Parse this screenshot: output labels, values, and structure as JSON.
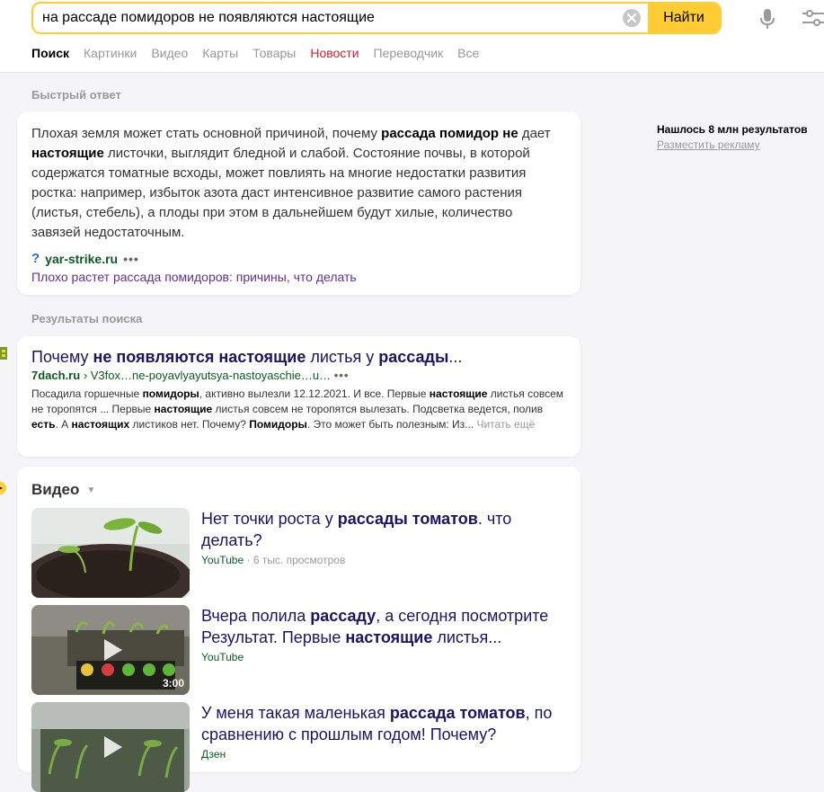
{
  "search": {
    "query": "на рассаде помидоров не появляются настоящие",
    "button": "Найти"
  },
  "tabs": [
    "Поиск",
    "Картинки",
    "Видео",
    "Карты",
    "Товары",
    "Новости",
    "Переводчик",
    "Все"
  ],
  "quick_answer": {
    "section_title": "Быстрый ответ",
    "text_parts": [
      {
        "t": "Плохая земля может стать основной причиной, почему "
      },
      {
        "t": "рассада помидор не",
        "b": true
      },
      {
        "t": " дает "
      },
      {
        "t": "настоящие",
        "b": true
      },
      {
        "t": " листочки, выглядит бледной и слабой. Состояние почвы, в которой содержатся томатные всходы, может повлиять на многие недостатки развития ростка: например, избыток азота даст интенсивное развитие самого растения (листья, стебель), а плоды при этом в дальнейшем будут хилые, количество завязей недостаточным."
      }
    ],
    "source_icon": "?",
    "source_host": "yar-strike.ru",
    "dots": "•••",
    "link_text": "Плохо растет рассада помидоров: причины, что делать"
  },
  "results": {
    "section_title": "Результаты поиска",
    "items": [
      {
        "title_parts": [
          {
            "t": "Почему "
          },
          {
            "t": "не появляются настоящие",
            "b": true
          },
          {
            "t": " листья у "
          },
          {
            "t": "рассады",
            "b": true
          },
          {
            "t": "..."
          }
        ],
        "host": "7dach.ru",
        "path": "› V3fox…ne-poyavlyayutsya-nastoyaschie…u…",
        "dots": "•••",
        "snippet_parts": [
          {
            "t": "Посадила горшечные "
          },
          {
            "t": "помидоры",
            "b": true
          },
          {
            "t": ", активно вылезли 12.12.2021. И все. Первые "
          },
          {
            "t": "настоящие",
            "b": true
          },
          {
            "t": " листья совсем не торопятся ... Первые "
          },
          {
            "t": "настоящие",
            "b": true
          },
          {
            "t": " листья совсем не торопятся вылезать. Подсветка ведется, полив "
          },
          {
            "t": "есть",
            "b": true
          },
          {
            "t": ". А "
          },
          {
            "t": "настоящих",
            "b": true
          },
          {
            "t": " листиков нет. Почему? "
          },
          {
            "t": "Помидоры",
            "b": true
          },
          {
            "t": ". Это может быть полезным: Из..."
          }
        ],
        "more": "Читать ещё"
      }
    ]
  },
  "videos": {
    "section_title": "Видео",
    "items": [
      {
        "title_parts": [
          {
            "t": "Нет точки роста у "
          },
          {
            "t": "рассады томатов",
            "b": true
          },
          {
            "t": ". что делать?"
          }
        ],
        "source": "YouTube",
        "views": "· 6 тыс. просмотров",
        "duration": ""
      },
      {
        "title_parts": [
          {
            "t": "Вчера полила "
          },
          {
            "t": "рассаду",
            "b": true
          },
          {
            "t": ", а сегодня посмотрите Результат. Первые "
          },
          {
            "t": "настоящие",
            "b": true
          },
          {
            "t": " листья..."
          }
        ],
        "source": "YouTube",
        "views": "",
        "duration": "3:00"
      },
      {
        "title_parts": [
          {
            "t": "У меня такая маленькая "
          },
          {
            "t": "рассада томатов",
            "b": true
          },
          {
            "t": ", по сравнению с прошлым годом! Почему?"
          }
        ],
        "source": "Дзен",
        "views": "",
        "duration": ""
      }
    ]
  },
  "sidebar_info": {
    "found": "Нашлось 8 млн результатов",
    "ad": "Разместить рекламу"
  },
  "colors": {
    "accent": "#ffcc33",
    "link": "#1b1464",
    "url": "#0a5a21",
    "news": "#c8232c"
  }
}
